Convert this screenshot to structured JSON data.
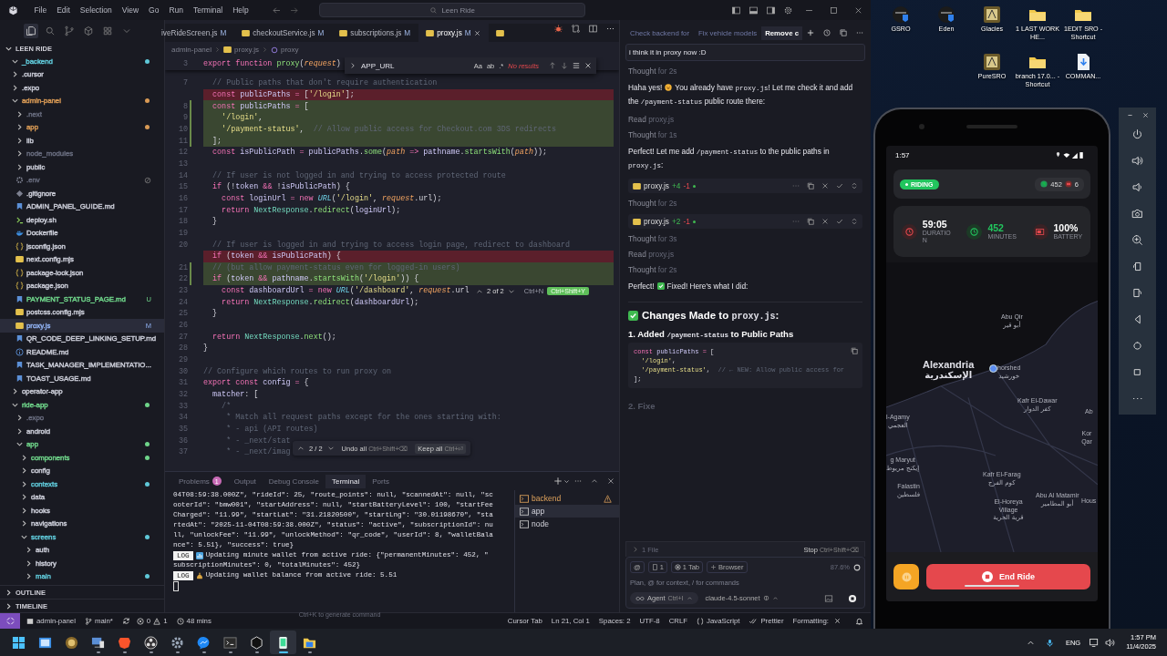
{
  "titlebar": {
    "menu": [
      "File",
      "Edit",
      "Selection",
      "View",
      "Go",
      "Run",
      "Terminal",
      "Help"
    ],
    "search": "Leen Ride"
  },
  "sidebar": {
    "title": "LEEN RIDE",
    "sections": [
      "OUTLINE",
      "TIMELINE"
    ],
    "tree": [
      {
        "name": "_backend",
        "kind": "folder",
        "expanded": true,
        "selected": false,
        "color": "#5fc8d8",
        "dot": true
      },
      {
        "name": ".cursor",
        "kind": "folder",
        "expanded": false,
        "selected": false,
        "dot": false
      },
      {
        "name": ".expo",
        "kind": "folder",
        "expanded": false,
        "selected": false,
        "dot": false
      },
      {
        "name": "admin-panel",
        "kind": "folder",
        "expanded": true,
        "selected": false,
        "color": "#d99a55",
        "dot": true,
        "children": [
          {
            "name": ".next",
            "kind": "folder",
            "expanded": false,
            "selected": false,
            "color": "#676b7d",
            "dot": false
          },
          {
            "name": "app",
            "kind": "folder",
            "expanded": false,
            "selected": false,
            "color": "#d99a55",
            "dot": true
          },
          {
            "name": "lib",
            "kind": "folder",
            "expanded": false,
            "selected": false,
            "dot": false
          },
          {
            "name": "node_modules",
            "kind": "folder",
            "expanded": false,
            "selected": false,
            "color": "#676b7d",
            "dot": false
          },
          {
            "name": "public",
            "kind": "folder",
            "expanded": false,
            "selected": false,
            "dot": false
          },
          {
            "name": ".env",
            "kind": "env",
            "selected": false,
            "color": "#676b7d",
            "dot": false
          },
          {
            "name": ".gitignore",
            "kind": "git",
            "selected": false,
            "dot": false
          },
          {
            "name": "ADMIN_PANEL_GUIDE.md",
            "kind": "md",
            "selected": false,
            "dot": false
          },
          {
            "name": "deploy.sh",
            "kind": "sh",
            "selected": false,
            "dot": false
          },
          {
            "name": "Dockerfile",
            "kind": "docker",
            "selected": false,
            "dot": false
          },
          {
            "name": "jsconfig.json",
            "kind": "json",
            "selected": false,
            "dot": false
          },
          {
            "name": "next.config.mjs",
            "kind": "js",
            "selected": false,
            "dot": false
          },
          {
            "name": "package-lock.json",
            "kind": "json",
            "selected": false,
            "dot": false
          },
          {
            "name": "package.json",
            "kind": "json",
            "selected": false,
            "dot": false
          },
          {
            "name": "PAYMENT_STATUS_PAGE.md",
            "kind": "md",
            "selected": false,
            "color": "#6fd58a",
            "dot": false,
            "badge": "U"
          },
          {
            "name": "postcss.config.mjs",
            "kind": "js",
            "selected": false,
            "dot": false
          },
          {
            "name": "proxy.js",
            "kind": "js",
            "selected": true,
            "color": "#8fb0f0",
            "dot": false,
            "badge": "M"
          },
          {
            "name": "QR_CODE_DEEP_LINKING_SETUP.md",
            "kind": "md",
            "selected": false,
            "dot": false
          },
          {
            "name": "README.md",
            "kind": "info",
            "selected": false,
            "dot": false
          },
          {
            "name": "TASK_MANAGER_IMPLEMENTATIO...",
            "kind": "md",
            "selected": false,
            "dot": false
          },
          {
            "name": "TOAST_USAGE.md",
            "kind": "md",
            "selected": false,
            "dot": false
          }
        ]
      },
      {
        "name": "operator-app",
        "kind": "folder",
        "expanded": false,
        "selected": false,
        "dot": false
      },
      {
        "name": "ride-app",
        "kind": "folder",
        "expanded": true,
        "selected": false,
        "color": "#6fd58a",
        "dot": true,
        "children": [
          {
            "name": ".expo",
            "kind": "folder",
            "expanded": false,
            "selected": false,
            "color": "#676b7d",
            "dot": false
          },
          {
            "name": "android",
            "kind": "folder",
            "expanded": false,
            "selected": false,
            "dot": false
          },
          {
            "name": "app",
            "kind": "folder",
            "expanded": true,
            "selected": false,
            "color": "#6fd58a",
            "dot": true,
            "children": [
              {
                "name": "components",
                "kind": "folder",
                "expanded": false,
                "selected": false,
                "color": "#6fd58a",
                "dot": true
              },
              {
                "name": "config",
                "kind": "folder",
                "expanded": false,
                "selected": false,
                "dot": false
              },
              {
                "name": "contexts",
                "kind": "folder",
                "expanded": false,
                "selected": false,
                "color": "#5fc8d8",
                "dot": true
              },
              {
                "name": "data",
                "kind": "folder",
                "expanded": false,
                "selected": false,
                "dot": false
              },
              {
                "name": "hooks",
                "kind": "folder",
                "expanded": false,
                "selected": false,
                "dot": false
              },
              {
                "name": "navigations",
                "kind": "folder",
                "expanded": false,
                "selected": false,
                "dot": false
              },
              {
                "name": "screens",
                "kind": "folder",
                "expanded": true,
                "selected": false,
                "color": "#5fc8d8",
                "dot": true,
                "children": [
                  {
                    "name": "auth",
                    "kind": "folder",
                    "expanded": false,
                    "selected": false,
                    "dot": false
                  },
                  {
                    "name": "history",
                    "kind": "folder",
                    "expanded": false,
                    "selected": false,
                    "dot": false
                  },
                  {
                    "name": "main",
                    "kind": "folder",
                    "expanded": false,
                    "selected": false,
                    "color": "#5fc8d8",
                    "dot": true
                  }
                ]
              }
            ]
          }
        ]
      }
    ]
  },
  "editor": {
    "tabs": [
      {
        "label": "iveRideScreen.js",
        "badge": "M",
        "kind": "partial",
        "selected": false
      },
      {
        "label": "checkoutService.js",
        "badge": "M",
        "kind": "js",
        "selected": false
      },
      {
        "label": "subscriptions.js",
        "badge": "M",
        "kind": "js",
        "selected": false
      },
      {
        "label": "proxy.js",
        "badge": "M",
        "kind": "js",
        "selected": true
      },
      {
        "kind": "js",
        "selected": false
      }
    ],
    "breadcrumb": [
      "admin-panel",
      "proxy.js",
      "proxy"
    ],
    "sticky": {
      "number": "3",
      "tokens": [
        {
          "kind": "kw",
          "text": "export function "
        },
        {
          "kind": "fn",
          "text": "proxy"
        },
        {
          "kind": "plain",
          "text": "("
        },
        {
          "kind": "param",
          "text": "request"
        },
        {
          "kind": "plain",
          "text": ")"
        }
      ]
    },
    "find": {
      "query": "APP_URL",
      "options": [
        "Aa",
        "ab",
        ".*"
      ],
      "result": "No results"
    },
    "rows": [
      {
        "number": "7",
        "kind": "context",
        "tokens": [
          {
            "kind": "cm",
            "text": "  // Public paths that don't require authentication"
          }
        ]
      },
      {
        "kind": "removed",
        "tokens": [
          {
            "kind": "kw",
            "text": "  const "
          },
          {
            "kind": "var",
            "text": "publicPaths"
          },
          {
            "kind": "op",
            "text": " = "
          },
          {
            "kind": "plain",
            "text": "["
          },
          {
            "kind": "str",
            "text": "'/login'"
          },
          {
            "kind": "plain",
            "text": "];"
          }
        ]
      },
      {
        "number": "8",
        "kind": "added",
        "tokens": [
          {
            "kind": "kw",
            "text": "  const "
          },
          {
            "kind": "var",
            "text": "publicPaths"
          },
          {
            "kind": "op",
            "text": " = "
          },
          {
            "kind": "plain",
            "text": "["
          }
        ]
      },
      {
        "number": "9",
        "kind": "added",
        "tokens": [
          {
            "kind": "str",
            "text": "    '/login'"
          },
          {
            "kind": "plain",
            "text": ","
          }
        ]
      },
      {
        "number": "10",
        "kind": "added",
        "tokens": [
          {
            "kind": "str",
            "text": "    '/payment-status'"
          },
          {
            "kind": "plain",
            "text": ",  "
          },
          {
            "kind": "cm",
            "text": "// Allow public access for Checkout.com 3DS redirects"
          }
        ]
      },
      {
        "number": "11",
        "kind": "added",
        "tokens": [
          {
            "kind": "plain",
            "text": "  ];"
          }
        ]
      },
      {
        "number": "12",
        "kind": "context",
        "tokens": [
          {
            "kind": "kw",
            "text": "  const "
          },
          {
            "kind": "var",
            "text": "isPublicPath"
          },
          {
            "kind": "op",
            "text": " = "
          },
          {
            "kind": "var",
            "text": "publicPaths"
          },
          {
            "kind": "plain",
            "text": "."
          },
          {
            "kind": "fn",
            "text": "some"
          },
          {
            "kind": "plain",
            "text": "("
          },
          {
            "kind": "param",
            "text": "path"
          },
          {
            "kind": "op",
            "text": " => "
          },
          {
            "kind": "var",
            "text": "pathname"
          },
          {
            "kind": "plain",
            "text": "."
          },
          {
            "kind": "fn",
            "text": "startsWith"
          },
          {
            "kind": "plain",
            "text": "("
          },
          {
            "kind": "param",
            "text": "path"
          },
          {
            "kind": "plain",
            "text": "));"
          }
        ]
      },
      {
        "number": "13",
        "kind": "context"
      },
      {
        "number": "14",
        "kind": "context",
        "tokens": [
          {
            "kind": "cm",
            "text": "  // If user is not logged in and trying to access protected route"
          }
        ]
      },
      {
        "number": "15",
        "kind": "context",
        "tokens": [
          {
            "kind": "kw",
            "text": "  if "
          },
          {
            "kind": "plain",
            "text": "(!"
          },
          {
            "kind": "var",
            "text": "token"
          },
          {
            "kind": "op",
            "text": " && "
          },
          {
            "kind": "plain",
            "text": "!"
          },
          {
            "kind": "var",
            "text": "isPublicPath"
          },
          {
            "kind": "plain",
            "text": ") {"
          }
        ]
      },
      {
        "number": "16",
        "kind": "context",
        "tokens": [
          {
            "kind": "kw",
            "text": "    const "
          },
          {
            "kind": "var",
            "text": "loginUrl"
          },
          {
            "kind": "op",
            "text": " = "
          },
          {
            "kind": "kw",
            "text": "new "
          },
          {
            "kind": "type",
            "text": "URL"
          },
          {
            "kind": "plain",
            "text": "("
          },
          {
            "kind": "str",
            "text": "'/login'"
          },
          {
            "kind": "plain",
            "text": ", "
          },
          {
            "kind": "param",
            "text": "request"
          },
          {
            "kind": "plain",
            "text": ".url);"
          }
        ]
      },
      {
        "number": "17",
        "kind": "context",
        "tokens": [
          {
            "kind": "kw",
            "text": "    return "
          },
          {
            "kind": "cls",
            "text": "NextResponse"
          },
          {
            "kind": "plain",
            "text": "."
          },
          {
            "kind": "fn",
            "text": "redirect"
          },
          {
            "kind": "plain",
            "text": "("
          },
          {
            "kind": "var",
            "text": "loginUrl"
          },
          {
            "kind": "plain",
            "text": ");"
          }
        ]
      },
      {
        "number": "18",
        "kind": "context",
        "tokens": [
          {
            "kind": "plain",
            "text": "  }"
          }
        ]
      },
      {
        "number": "19",
        "kind": "context"
      },
      {
        "number": "20",
        "kind": "context",
        "tokens": [
          {
            "kind": "cm",
            "text": "  // If user is logged in and trying to access login page, redirect to dashboard"
          }
        ]
      },
      {
        "kind": "removed",
        "tokens": [
          {
            "kind": "kw",
            "text": "  if "
          },
          {
            "kind": "plain",
            "text": "("
          },
          {
            "kind": "var",
            "text": "token"
          },
          {
            "kind": "op",
            "text": " && "
          },
          {
            "kind": "var",
            "text": "isPublicPath"
          },
          {
            "kind": "plain",
            "text": ") {"
          }
        ]
      },
      {
        "number": "21",
        "kind": "added",
        "tokens": [
          {
            "kind": "cm",
            "text": "  // (but allow payment-status even for logged-in users)"
          }
        ]
      },
      {
        "number": "22",
        "kind": "added",
        "tokens": [
          {
            "kind": "kw",
            "text": "  if "
          },
          {
            "kind": "plain",
            "text": "("
          },
          {
            "kind": "var",
            "text": "token"
          },
          {
            "kind": "op",
            "text": " && "
          },
          {
            "kind": "var",
            "text": "pathname"
          },
          {
            "kind": "plain",
            "text": "."
          },
          {
            "kind": "fn",
            "text": "startsWith"
          },
          {
            "kind": "plain",
            "text": "("
          },
          {
            "kind": "str",
            "text": "'/login'"
          },
          {
            "kind": "plain",
            "text": ")) {"
          }
        ]
      },
      {
        "number": "23",
        "kind": "context",
        "tokens": [
          {
            "kind": "kw",
            "text": "    const "
          },
          {
            "kind": "var",
            "text": "dashboardUrl"
          },
          {
            "kind": "op",
            "text": " = "
          },
          {
            "kind": "kw",
            "text": "new "
          },
          {
            "kind": "type",
            "text": "URL"
          },
          {
            "kind": "plain",
            "text": "("
          },
          {
            "kind": "str",
            "text": "'/dashboard'"
          },
          {
            "kind": "plain",
            "text": ", "
          },
          {
            "kind": "param",
            "text": "request"
          },
          {
            "kind": "plain",
            "text": ".url"
          }
        ]
      },
      {
        "number": "24",
        "kind": "context",
        "tokens": [
          {
            "kind": "kw",
            "text": "    return "
          },
          {
            "kind": "cls",
            "text": "NextResponse"
          },
          {
            "kind": "plain",
            "text": "."
          },
          {
            "kind": "fn",
            "text": "redirect"
          },
          {
            "kind": "plain",
            "text": "("
          },
          {
            "kind": "var",
            "text": "dashboardUrl"
          },
          {
            "kind": "plain",
            "text": ");"
          }
        ]
      },
      {
        "number": "25",
        "kind": "context",
        "tokens": [
          {
            "kind": "plain",
            "text": "  }"
          }
        ]
      },
      {
        "number": "26",
        "kind": "context"
      },
      {
        "number": "27",
        "kind": "context",
        "tokens": [
          {
            "kind": "kw",
            "text": "  return "
          },
          {
            "kind": "cls",
            "text": "NextResponse"
          },
          {
            "kind": "plain",
            "text": "."
          },
          {
            "kind": "fn",
            "text": "next"
          },
          {
            "kind": "plain",
            "text": "();"
          }
        ]
      },
      {
        "number": "28",
        "kind": "context",
        "tokens": [
          {
            "kind": "plain",
            "text": "}"
          }
        ]
      },
      {
        "number": "29",
        "kind": "context"
      },
      {
        "number": "30",
        "kind": "context",
        "tokens": [
          {
            "kind": "cm",
            "text": "// Configure which routes to run proxy on"
          }
        ]
      },
      {
        "number": "31",
        "kind": "context",
        "tokens": [
          {
            "kind": "kw",
            "text": "export const "
          },
          {
            "kind": "var",
            "text": "config"
          },
          {
            "kind": "op",
            "text": " = "
          },
          {
            "kind": "plain",
            "text": "{"
          }
        ]
      },
      {
        "number": "32",
        "kind": "context",
        "tokens": [
          {
            "kind": "var",
            "text": "  matcher"
          },
          {
            "kind": "plain",
            "text": ": ["
          }
        ]
      },
      {
        "number": "33",
        "kind": "context",
        "tokens": [
          {
            "kind": "cm",
            "text": "    /*"
          }
        ]
      },
      {
        "number": "34",
        "kind": "context",
        "tokens": [
          {
            "kind": "cm",
            "text": "     * Match all request paths except for the ones starting with:"
          }
        ]
      },
      {
        "number": "35",
        "kind": "context",
        "tokens": [
          {
            "kind": "cm",
            "text": "     * - api (API routes)"
          }
        ]
      },
      {
        "number": "36",
        "kind": "context",
        "tokens": [
          {
            "kind": "cm",
            "text": "     * - _next/stat"
          }
        ]
      },
      {
        "number": "37",
        "kind": "context",
        "tokens": [
          {
            "kind": "cm",
            "text": "     * - _next/imag"
          }
        ]
      }
    ],
    "diff_widget": {
      "counter": "2 of 2",
      "shortcut": "Ctrl+N",
      "accept": "Ctrl+Shift+Y"
    },
    "review_bar": {
      "counter": "2 / 2",
      "undo": "Undo all",
      "undo_shortcut": "Ctrl+Shift+⌫",
      "keep": "Keep all",
      "keep_shortcut": "Ctrl+⏎"
    }
  },
  "panel": {
    "tabs": [
      {
        "label": "Problems",
        "badge": "1",
        "selected": false
      },
      {
        "label": "Output",
        "selected": false
      },
      {
        "label": "Debug Console",
        "selected": false
      },
      {
        "label": "Terminal",
        "selected": true
      },
      {
        "label": "Ports",
        "selected": false
      }
    ],
    "lines": [
      {
        "kind": "text",
        "text": "04T08:59:38.000Z\", \"rideId\": 25, \"route_points\": null, \"scannedAt\": null, \"sc"
      },
      {
        "kind": "text",
        "text": "ooterId\": \"bmw001\", \"startAddress\": null, \"startBatteryLevel\": 100, \"startFee"
      },
      {
        "kind": "text",
        "text": "Charged\": \"11.99\", \"startLat\": \"31.21820500\", \"startLng\": \"30.01198670\", \"sta"
      },
      {
        "kind": "text",
        "text": "rtedAt\": \"2025-11-04T08:59:38.000Z\", \"status\": \"active\", \"subscriptionId\": nu"
      },
      {
        "kind": "text",
        "text": "ll, \"unlockFee\": \"11.99\", \"unlockMethod\": \"qr_code\", \"userId\": 8, \"walletBala"
      },
      {
        "kind": "text",
        "text": "nce\": 5.51}, \"success\": true}"
      },
      {
        "kind": "chart",
        "tag": "LOG",
        "text": "Updating minute wallet from active ride: {\"permanentMinutes\": 452, \""
      },
      {
        "kind": "text",
        "text": "subscriptionMinutes\": 0, \"totalMinutes\": 452}"
      },
      {
        "kind": "money",
        "tag": "LOG",
        "text": "Updating wallet balance from active ride: 5.51"
      },
      {
        "kind": "cursor"
      }
    ],
    "hint": "Ctrl+K to generate command",
    "sessions": [
      {
        "label": "backend",
        "warning": true,
        "selected": false
      },
      {
        "label": "app",
        "warning": false,
        "selected": true
      },
      {
        "label": "node",
        "warning": false,
        "selected": false
      }
    ]
  },
  "status_bar": {
    "workspace": "admin-panel",
    "branch": "main*",
    "errors": "0",
    "warnings": "1",
    "timer": "48 mins",
    "right": [
      {
        "kind": "text",
        "text": "Cursor Tab"
      },
      {
        "kind": "text",
        "text": "Ln 21, Col 1"
      },
      {
        "kind": "text",
        "text": "Spaces: 2"
      },
      {
        "kind": "text",
        "text": "UTF-8"
      },
      {
        "kind": "text",
        "text": "CRLF"
      },
      {
        "kind": "language",
        "text": "JavaScript"
      },
      {
        "kind": "prettier",
        "text": "Prettier"
      },
      {
        "kind": "formatting",
        "text": "Formatting:"
      }
    ]
  },
  "chat": {
    "tabs": [
      {
        "label": "Check backend for",
        "selected": false
      },
      {
        "label": "Fix vehicle models",
        "selected": false
      },
      {
        "label": "Remove c",
        "selected": true
      }
    ],
    "prompt": "i think it in proxy now :D",
    "items": [
      {
        "kind": "thought",
        "label": "Thought",
        "detail": "for 2s"
      },
      {
        "kind": "message",
        "parts": [
          {
            "kind": "text",
            "segments": [
              {
                "kind": "plain",
                "text": "Haha yes!"
              }
            ]
          },
          {
            "kind": "smiley"
          },
          {
            "kind": "text",
            "segments": [
              {
                "kind": "plain",
                "text": "You already have "
              },
              {
                "kind": "code",
                "text": "proxy.js"
              },
              {
                "kind": "plain",
                "text": "! Let me check it and add the "
              },
              {
                "kind": "code",
                "text": "/payment-status"
              },
              {
                "kind": "plain",
                "text": " public route there:"
              }
            ]
          }
        ]
      },
      {
        "kind": "read",
        "label": "Read",
        "detail": "proxy.js"
      },
      {
        "kind": "thought",
        "label": "Thought",
        "detail": "for 1s"
      },
      {
        "kind": "message",
        "parts": [
          {
            "kind": "text",
            "segments": [
              {
                "kind": "plain",
                "text": "Perfect! Let me add "
              },
              {
                "kind": "code",
                "text": "/payment-status"
              },
              {
                "kind": "plain",
                "text": " to the public paths in "
              },
              {
                "kind": "code",
                "text": "proxy.js"
              },
              {
                "kind": "plain",
                "text": ":"
              }
            ]
          }
        ]
      },
      {
        "kind": "edit",
        "file": "proxy.js",
        "added": "+4",
        "removed": "-1"
      },
      {
        "kind": "thought",
        "label": "Thought",
        "detail": "for 2s"
      },
      {
        "kind": "edit",
        "file": "proxy.js",
        "added": "+2",
        "removed": "-1"
      },
      {
        "kind": "thought",
        "label": "Thought",
        "detail": "for 3s"
      },
      {
        "kind": "read",
        "label": "Read",
        "detail": "proxy.js"
      },
      {
        "kind": "thought",
        "label": "Thought",
        "detail": "for 2s"
      },
      {
        "kind": "message",
        "parts": [
          {
            "kind": "text",
            "segments": [
              {
                "kind": "plain",
                "text": "Perfect!"
              }
            ]
          },
          {
            "kind": "check"
          },
          {
            "kind": "text",
            "segments": [
              {
                "kind": "plain",
                "text": "Fixed! Here's what I did:"
              }
            ]
          }
        ]
      },
      {
        "kind": "heading",
        "segments": [
          {
            "kind": "plain",
            "text": "Changes Made to "
          },
          {
            "kind": "code",
            "text": "proxy.js"
          },
          {
            "kind": "plain",
            "text": ":"
          }
        ]
      },
      {
        "kind": "subheading",
        "segments": [
          {
            "kind": "plain",
            "text": "1. Added "
          },
          {
            "kind": "code",
            "text": "/payment-status"
          },
          {
            "kind": "plain",
            "text": " to Public Paths"
          }
        ]
      },
      {
        "kind": "code",
        "lines": [
          [
            {
              "kind": "kw",
              "text": "const "
            },
            {
              "kind": "var",
              "text": "publicPaths"
            },
            {
              "kind": "op",
              "text": " = "
            },
            {
              "kind": "plain",
              "text": "["
            }
          ],
          [
            {
              "kind": "str",
              "text": "  '/login'"
            },
            {
              "kind": "plain",
              "text": ","
            }
          ],
          [
            {
              "kind": "str",
              "text": "  '/payment-status'"
            },
            {
              "kind": "plain",
              "text": ",  "
            },
            {
              "kind": "cm",
              "text": "// ← NEW: Allow public access for"
            }
          ],
          [
            {
              "kind": "plain",
              "text": "];"
            }
          ]
        ]
      },
      {
        "kind": "pending",
        "segments": [
          {
            "kind": "plain",
            "text": "2. Fixe"
          }
        ]
      }
    ],
    "files": "1 File",
    "stop": "Stop",
    "stop_shortcut": "Ctrl+Shift+⌫",
    "chips": [
      {
        "kind": "mention",
        "text": "@"
      },
      {
        "kind": "doc",
        "text": "1"
      },
      {
        "kind": "tab",
        "text": "1 Tab"
      },
      {
        "kind": "browser",
        "text": "Browser"
      }
    ],
    "context": "87.6%",
    "placeholder": "Plan, @ for context, / for commands",
    "mode": "Agent",
    "mode_shortcut": "Ctrl+I",
    "model": "claude-4.5-sonnet"
  },
  "desktop": {
    "icons": [
      {
        "label": "GSRO",
        "kind": "app"
      },
      {
        "label": "Eden",
        "kind": "app"
      },
      {
        "label": "Glacies",
        "kind": "game"
      },
      {
        "label": "1 LAST WORK HE...",
        "kind": "folder"
      },
      {
        "label": "1EDIT SRO - Shortcut",
        "kind": "folder"
      },
      {
        "label": "PureSRO",
        "kind": "game"
      },
      {
        "label": "branch 17.0... - Shortcut",
        "kind": "folder"
      },
      {
        "label": "COMMAN...",
        "kind": "file"
      }
    ]
  },
  "phone": {
    "time": "1:57",
    "ride": {
      "status": "RIDING",
      "minutes": "452",
      "count": "6"
    },
    "stats": [
      {
        "kind": "duration",
        "value": "59:05",
        "label": "DURATION"
      },
      {
        "kind": "minutes",
        "value": "452",
        "label": "MINUTES"
      },
      {
        "kind": "battery",
        "value": "100%",
        "label": "BATTERY"
      }
    ],
    "map_labels": [
      {
        "name": "Abu Qir",
        "local": "أبو قير"
      },
      {
        "name": "Alexandria",
        "local": "الإسكندرية",
        "kind": "city"
      },
      {
        "name": "horshed",
        "local": "خورشيد"
      },
      {
        "name": "Kafr El-Dawar",
        "local": "كفر الدوار"
      },
      {
        "name": "Ab"
      },
      {
        "name": "l-Agamy",
        "local": "العجمي"
      },
      {
        "name": "Kor Qar"
      },
      {
        "name": "g Maryut",
        "local": "إيكنج مريوط"
      },
      {
        "name": "Kafr El-Farag",
        "local": "كوم الفرج"
      },
      {
        "name": "Falastin",
        "local": "فلسطين"
      },
      {
        "name": "El-Horeya Village",
        "local": "قرية الحرية"
      },
      {
        "name": "Abu Al Matamir",
        "local": "أبو المطامير"
      },
      {
        "name": "Hous"
      }
    ],
    "end_ride": "End Ride"
  },
  "taskbar": {
    "apps": [
      {
        "kind": "start",
        "selected": false,
        "running": false
      },
      {
        "kind": "window",
        "selected": false,
        "running": false
      },
      {
        "kind": "badge",
        "selected": false,
        "running": false
      },
      {
        "kind": "computer",
        "selected": false,
        "running": true
      },
      {
        "kind": "lion",
        "selected": false,
        "running": true
      },
      {
        "kind": "obs",
        "selected": false,
        "running": true
      },
      {
        "kind": "settings",
        "selected": false,
        "running": true
      },
      {
        "kind": "messenger",
        "selected": false,
        "running": true
      },
      {
        "kind": "terminal",
        "selected": false,
        "running": true
      },
      {
        "kind": "cube",
        "selected": false,
        "running": true
      },
      {
        "kind": "phone",
        "selected": true,
        "running": true
      },
      {
        "kind": "folder",
        "selected": false,
        "running": true
      }
    ],
    "language": "ENG",
    "time": "1:57 PM",
    "date": "11/4/2025"
  }
}
